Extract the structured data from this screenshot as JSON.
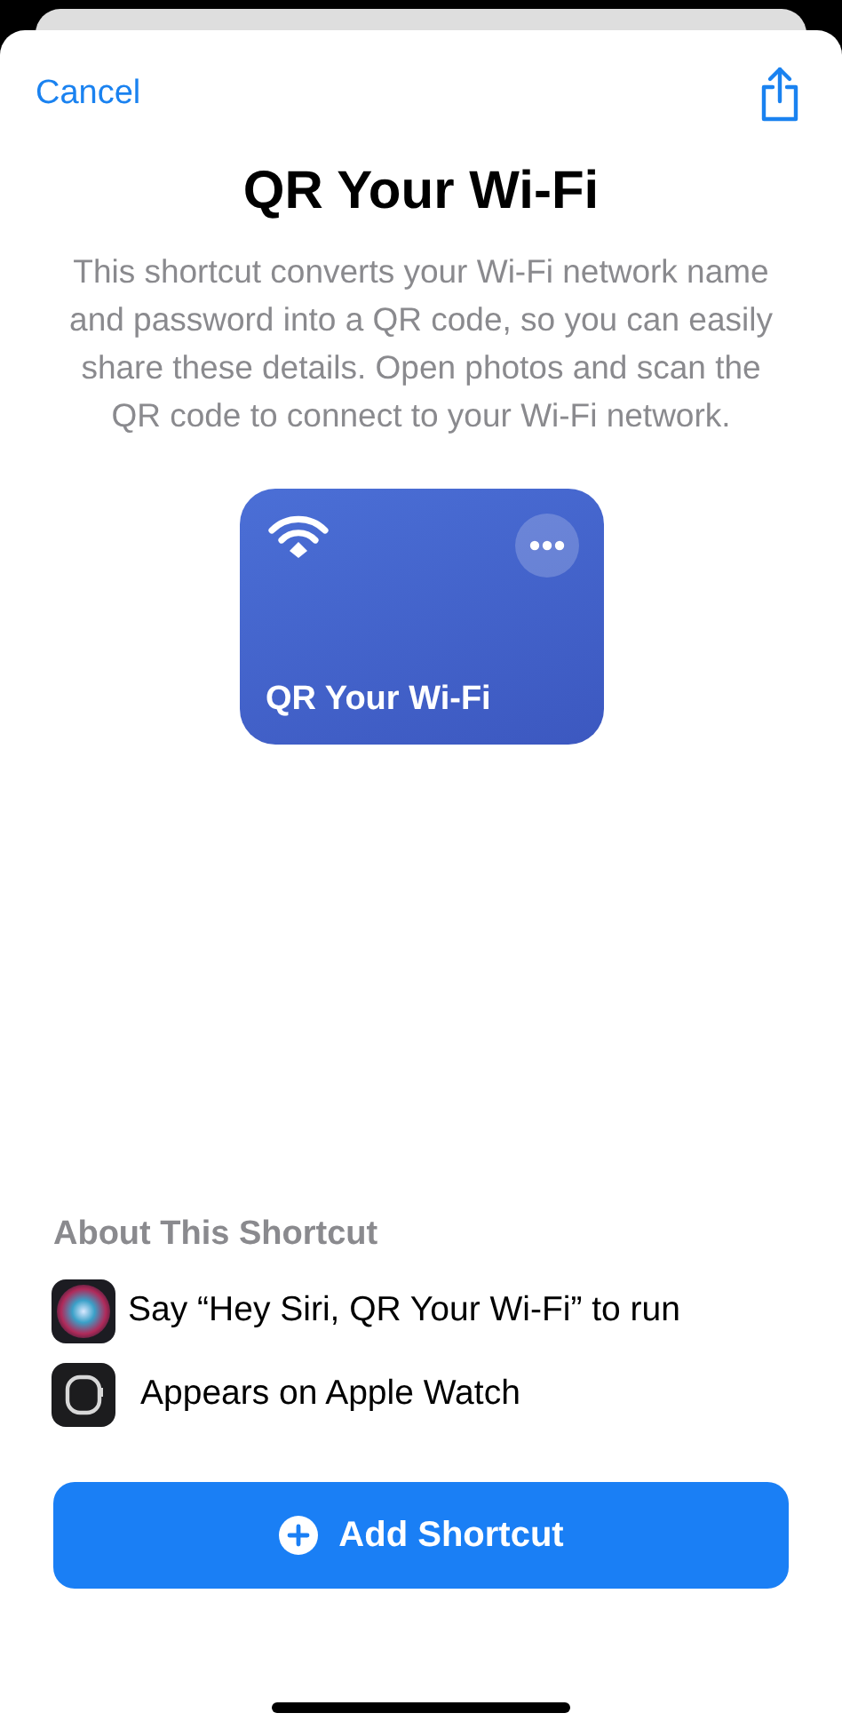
{
  "nav": {
    "cancel": "Cancel"
  },
  "title": "QR Your Wi-Fi",
  "description": "This shortcut converts your Wi-Fi network name and password into a QR code, so you can easily share these details. Open photos and scan the QR code to connect to your Wi-Fi network.",
  "card": {
    "name": "QR Your Wi-Fi"
  },
  "about": {
    "heading": "About This Shortcut",
    "items": [
      {
        "kind": "siri",
        "text": "Say “Hey Siri, QR Your Wi-Fi” to run"
      },
      {
        "kind": "watch",
        "text": "Appears on Apple Watch"
      }
    ]
  },
  "button": "Add Shortcut"
}
